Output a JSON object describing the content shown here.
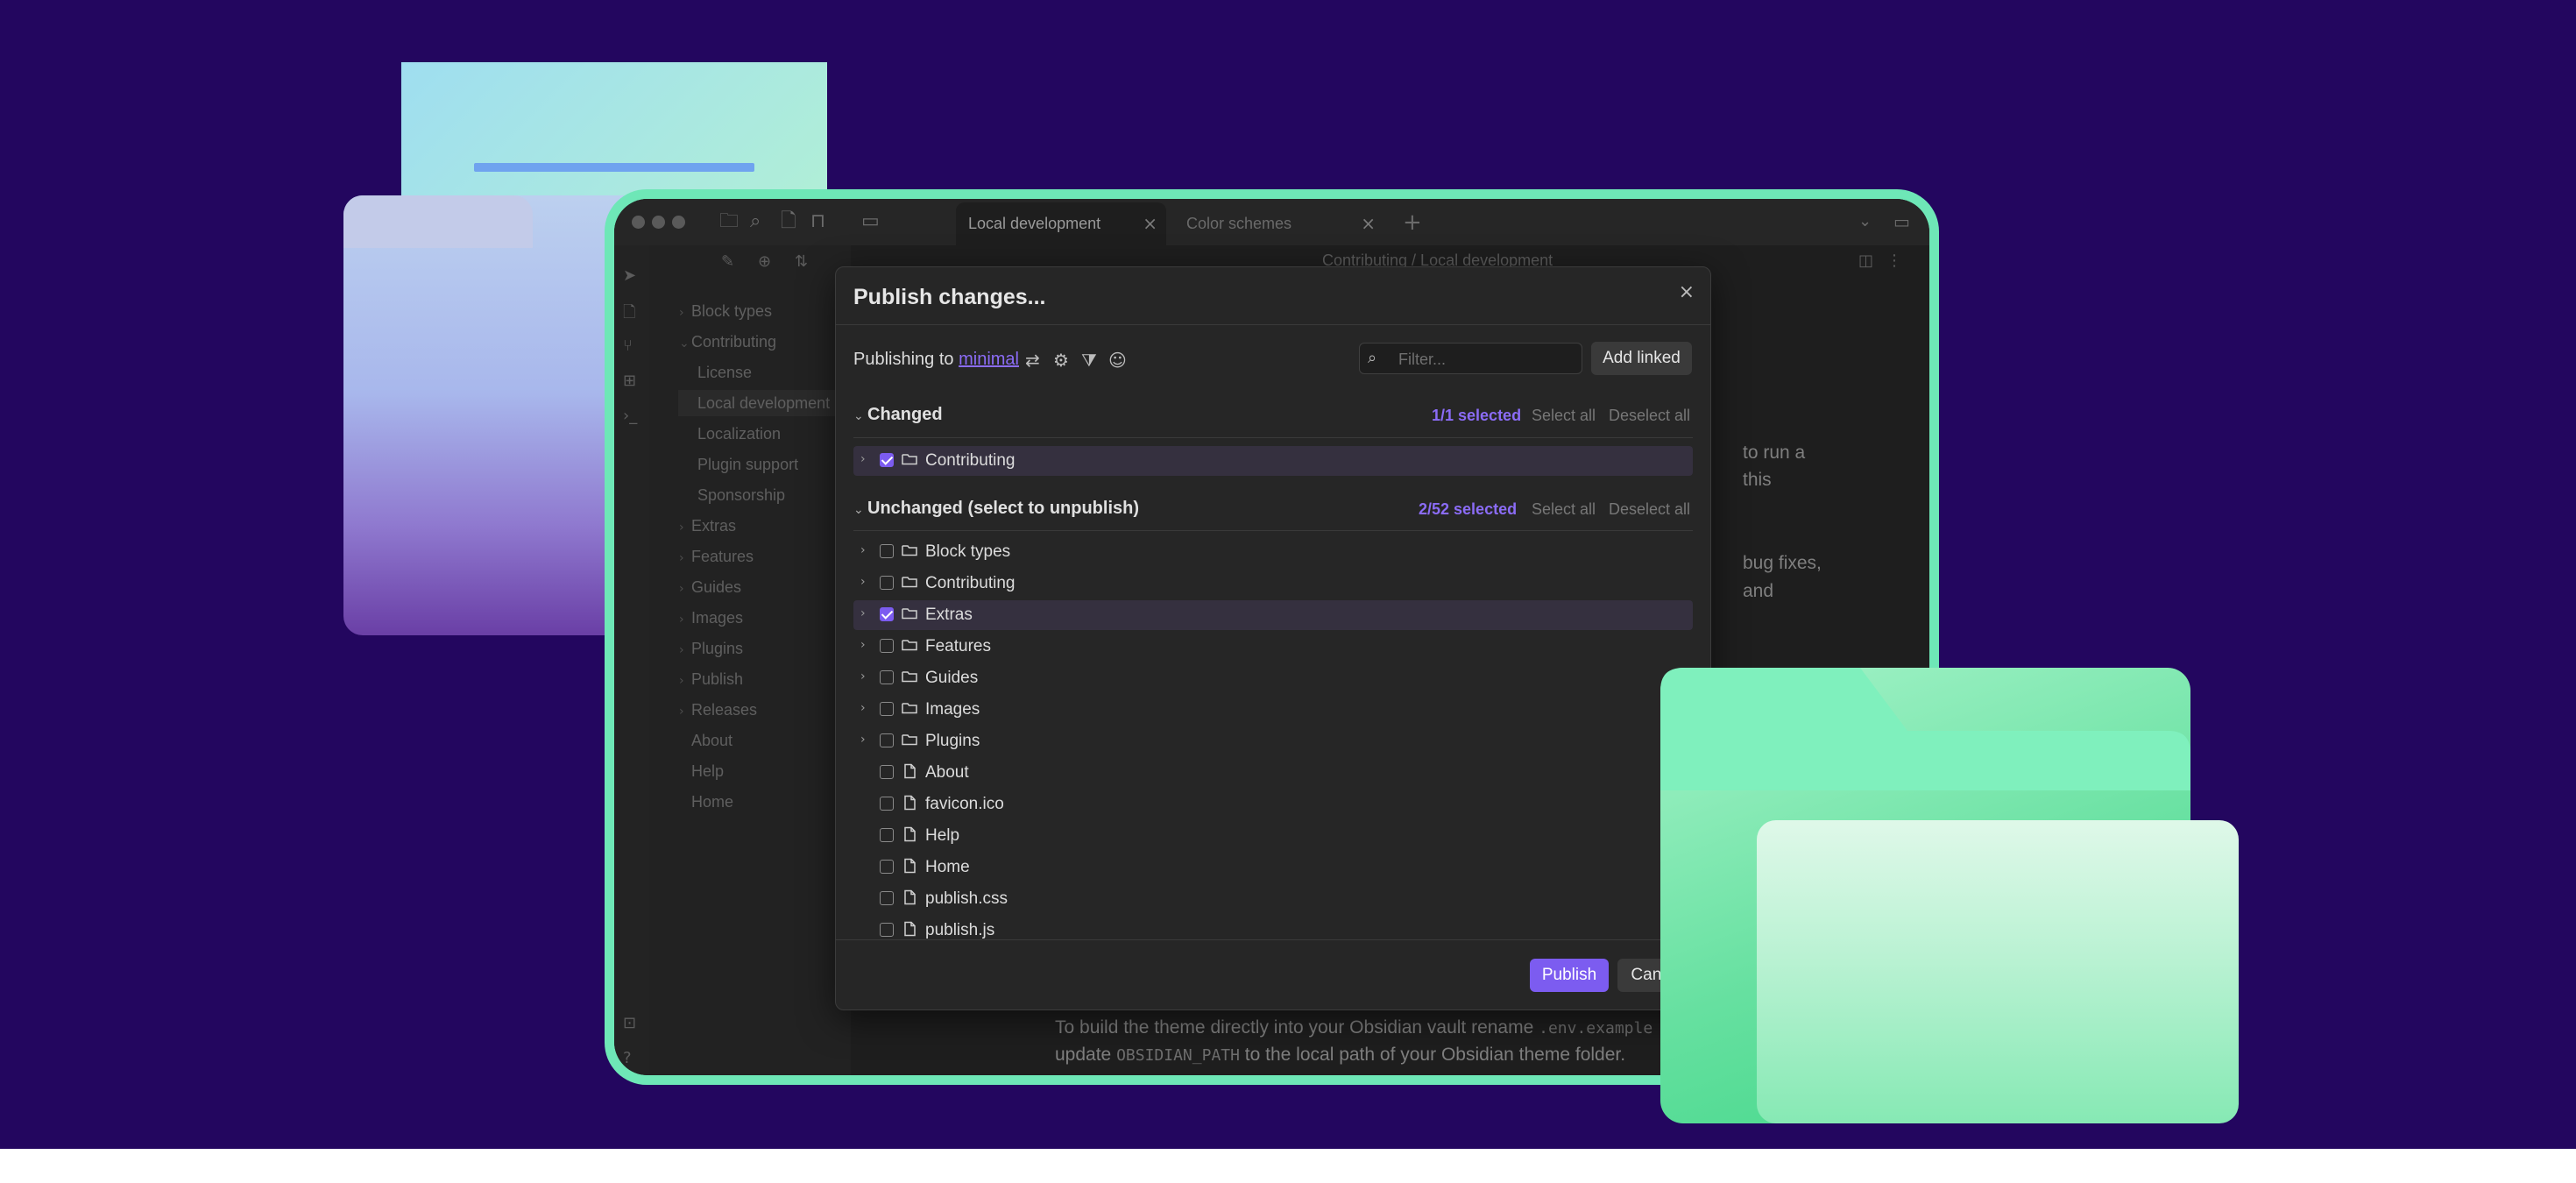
{
  "window": {
    "tabs": [
      {
        "label": "Local development",
        "close": "×"
      },
      {
        "label": "Color schemes",
        "close": "×"
      }
    ],
    "new_tab": "+",
    "breadcrumb": "Contributing / Local development"
  },
  "sidebar": {
    "items": [
      {
        "label": "Block types",
        "chev": "›"
      },
      {
        "label": "Contributing",
        "chev": "⌄"
      },
      {
        "label": "License",
        "chev": ""
      },
      {
        "label": "Local development",
        "chev": ""
      },
      {
        "label": "Localization",
        "chev": ""
      },
      {
        "label": "Plugin support",
        "chev": ""
      },
      {
        "label": "Sponsorship",
        "chev": ""
      },
      {
        "label": "Extras",
        "chev": "›"
      },
      {
        "label": "Features",
        "chev": "›"
      },
      {
        "label": "Guides",
        "chev": "›"
      },
      {
        "label": "Images",
        "chev": "›"
      },
      {
        "label": "Plugins",
        "chev": "›"
      },
      {
        "label": "Publish",
        "chev": "›"
      },
      {
        "label": "Releases",
        "chev": "›"
      },
      {
        "label": "About",
        "chev": ""
      },
      {
        "label": "Help",
        "chev": ""
      },
      {
        "label": "Home",
        "chev": ""
      }
    ]
  },
  "editor": {
    "frag1": "to run a",
    "frag2": "this",
    "frag3": "bug fixes,",
    "frag4": "and",
    "line1_pre": "To build the theme directly into your Obsidian vault rename ",
    "line1_code": ".env.example",
    "line2_pre": "update ",
    "line2_code": "OBSIDIAN_PATH",
    "line2_post": " to the local path of your Obsidian theme folder."
  },
  "dialog": {
    "title": "Publish changes...",
    "close": "×",
    "publishing_to_label": "Publishing to",
    "site_name": "minimal",
    "filter_placeholder": "Filter...",
    "add_linked_label": "Add linked",
    "changed": {
      "title": "Changed",
      "count": "1/1 selected",
      "select_all": "Select all",
      "deselect_all": "Deselect all",
      "rows": [
        {
          "label": "Contributing",
          "type": "folder",
          "checked": true
        }
      ]
    },
    "unchanged": {
      "title": "Unchanged (select to unpublish)",
      "count": "2/52 selected",
      "select_all": "Select all",
      "deselect_all": "Deselect all",
      "rows": [
        {
          "label": "Block types",
          "type": "folder",
          "checked": false
        },
        {
          "label": "Contributing",
          "type": "folder",
          "checked": false
        },
        {
          "label": "Extras",
          "type": "folder",
          "checked": true
        },
        {
          "label": "Features",
          "type": "folder",
          "checked": false
        },
        {
          "label": "Guides",
          "type": "folder",
          "checked": false
        },
        {
          "label": "Images",
          "type": "folder",
          "checked": false
        },
        {
          "label": "Plugins",
          "type": "folder",
          "checked": false
        },
        {
          "label": "About",
          "type": "file",
          "checked": false
        },
        {
          "label": "favicon.ico",
          "type": "file",
          "checked": false
        },
        {
          "label": "Help",
          "type": "file",
          "checked": false
        },
        {
          "label": "Home",
          "type": "file",
          "checked": false
        },
        {
          "label": "publish.css",
          "type": "file",
          "checked": false
        },
        {
          "label": "publish.js",
          "type": "file",
          "checked": false
        }
      ]
    },
    "publish_label": "Publish",
    "cancel_label": "Cancel"
  },
  "colors": {
    "background": "#23065f",
    "frame": "#6ee7b7",
    "accent": "#7c5cf0"
  },
  "icons": [
    "folder-icon",
    "search-icon",
    "file-icon",
    "bookmark-icon",
    "sidebar-toggle-icon",
    "sync-icon",
    "gear-icon",
    "filter-icon",
    "palette-icon",
    "chevron-right-icon",
    "chevron-down-icon"
  ]
}
